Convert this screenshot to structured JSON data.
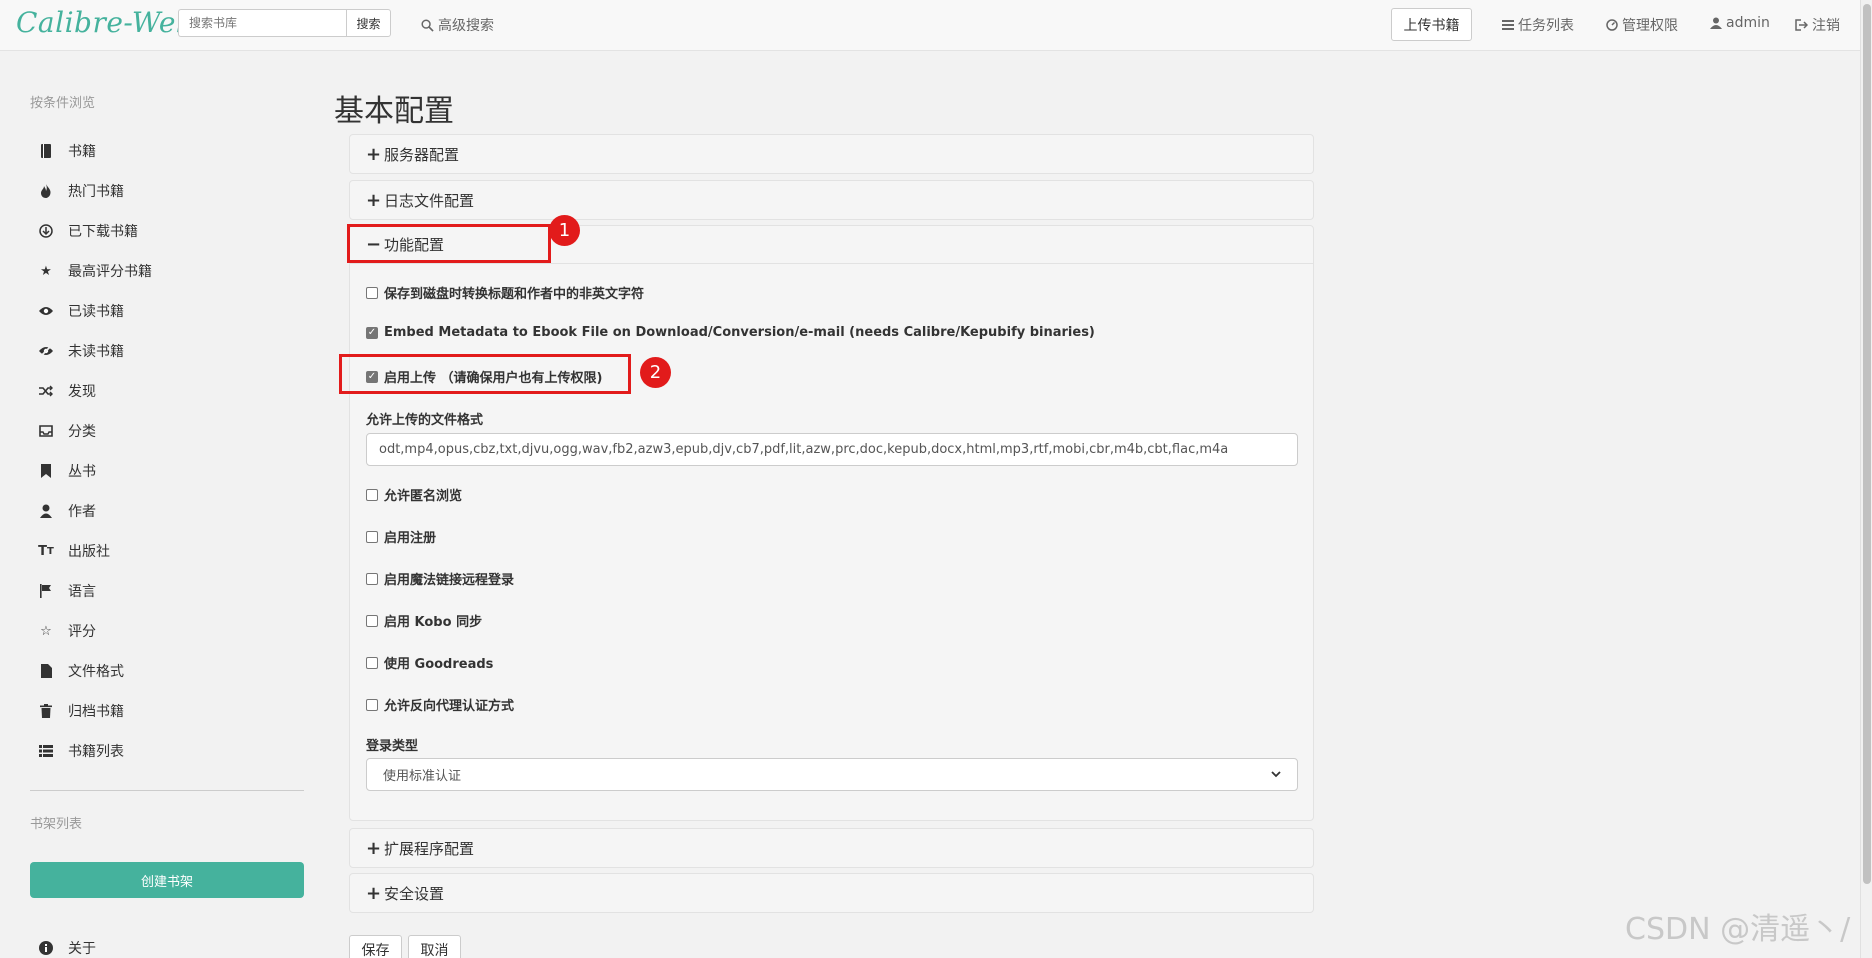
{
  "navbar": {
    "brand": "Calibre-Web",
    "search_placeholder": "搜索书库",
    "search_button": "搜索",
    "advanced_search": "高级搜索",
    "upload_button": "上传书籍",
    "tasks": "任务列表",
    "admin_settings": "管理权限",
    "user": "admin",
    "logout": "注销"
  },
  "sidebar": {
    "heading": "按条件浏览",
    "items": [
      {
        "label": "书籍",
        "icon": "book-icon"
      },
      {
        "label": "热门书籍",
        "icon": "fire-icon"
      },
      {
        "label": "已下载书籍",
        "icon": "download-icon"
      },
      {
        "label": "最高评分书籍",
        "icon": "star-icon"
      },
      {
        "label": "已读书籍",
        "icon": "eye-open-icon"
      },
      {
        "label": "未读书籍",
        "icon": "eye-close-icon"
      },
      {
        "label": "发现",
        "icon": "random-icon"
      },
      {
        "label": "分类",
        "icon": "inbox-icon"
      },
      {
        "label": "丛书",
        "icon": "bookmark-icon"
      },
      {
        "label": "作者",
        "icon": "user-icon"
      },
      {
        "label": "出版社",
        "icon": "text-size-icon"
      },
      {
        "label": "语言",
        "icon": "flag-icon"
      },
      {
        "label": "评分",
        "icon": "star-empty-icon"
      },
      {
        "label": "文件格式",
        "icon": "file-icon"
      },
      {
        "label": "归档书籍",
        "icon": "trash-icon"
      },
      {
        "label": "书籍列表",
        "icon": "list-icon"
      }
    ],
    "shelves_heading": "书架列表",
    "create_shelf": "创建书架",
    "about": "关于"
  },
  "main": {
    "title": "基本配置",
    "panels": {
      "server": "服务器配置",
      "logfile": "日志文件配置",
      "feature": "功能配置",
      "external": "扩展程序配置",
      "security": "安全设置"
    },
    "feature": {
      "unicode_filename": "保存到磁盘时转换标题和作者中的非英文字符",
      "embed_metadata": "Embed Metadata to Ebook File on Download/Conversion/e-mail (needs Calibre/Kepubify binaries)",
      "enable_upload": "启用上传 （请确保用户也有上传权限)",
      "upload_formats_label": "允许上传的文件格式",
      "upload_formats_value": "odt,mp4,opus,cbz,txt,djvu,ogg,wav,fb2,azw3,epub,djv,cb7,pdf,lit,azw,prc,doc,kepub,docx,html,mp3,rtf,mobi,cbr,m4b,cbt,flac,m4a",
      "anonymous_browse": "允许匿名浏览",
      "public_registration": "启用注册",
      "remote_login": "启用魔法链接远程登录",
      "kobo_sync": "启用 Kobo 同步",
      "goodreads": "使用 Goodreads",
      "reverse_proxy": "允许反向代理认证方式",
      "login_type_label": "登录类型",
      "login_type_value": "使用标准认证"
    },
    "checkbox_states": {
      "unicode_filename": false,
      "embed_metadata": true,
      "enable_upload": true,
      "anonymous_browse": false,
      "public_registration": false,
      "remote_login": false,
      "kobo_sync": false,
      "goodreads": false,
      "reverse_proxy": false
    },
    "buttons": {
      "save": "保存",
      "cancel": "取消"
    }
  },
  "annotations": {
    "callout_1": "1",
    "callout_2": "2"
  },
  "watermark": "CSDN @清遥丶/",
  "colors": {
    "accent": "#45b29d",
    "annotation_red": "#e21b1b"
  }
}
